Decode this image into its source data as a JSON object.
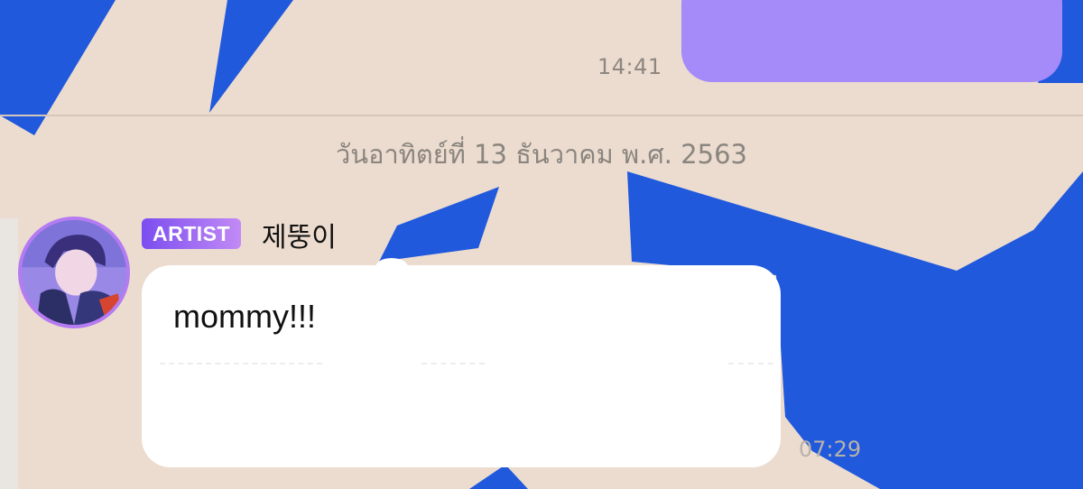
{
  "colors": {
    "wallpaper_base": "#ecdccf",
    "wallpaper_shape": "#2059dc",
    "outgoing_bubble": "#a58bfa",
    "artist_badge_start": "#7b4df0",
    "artist_badge_end": "#c28af5",
    "avatar_ring": "#b57bf2",
    "incoming_bubble": "#ffffff"
  },
  "outgoing_message": {
    "text": "",
    "time": "14:41"
  },
  "date_separator": "วันอาทิตย์ที่ 13 ธันวาคม พ.ศ. 2563",
  "incoming_message": {
    "avatar_icon": "artist-profile-photo",
    "badge": "ARTIST",
    "sender": "제뚱이",
    "text": "mommy!!!",
    "time": "07:29"
  }
}
